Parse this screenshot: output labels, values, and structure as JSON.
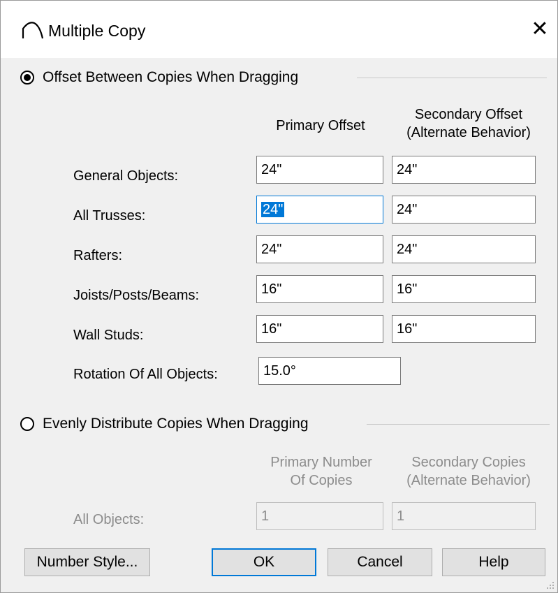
{
  "window": {
    "title": "Multiple Copy",
    "app_icon": "roof-arc-icon",
    "close_glyph": "✕"
  },
  "offset_group": {
    "label": "Offset Between Copies When Dragging",
    "selected": true,
    "col_primary": "Primary Offset",
    "col_secondary_line1": "Secondary Offset",
    "col_secondary_line2": "(Alternate Behavior)",
    "rows": [
      {
        "label": "General Objects:",
        "primary": "24\"",
        "secondary": "24\""
      },
      {
        "label": "All Trusses:",
        "primary": "24\"",
        "secondary": "24\""
      },
      {
        "label": "Rafters:",
        "primary": "24\"",
        "secondary": "24\""
      },
      {
        "label": "Joists/Posts/Beams:",
        "primary": "16\"",
        "secondary": "16\""
      },
      {
        "label": "Wall Studs:",
        "primary": "16\"",
        "secondary": "16\""
      }
    ],
    "rotation_label": "Rotation Of All Objects:",
    "rotation_value": "15.0°"
  },
  "distribute_group": {
    "label": "Evenly Distribute Copies When Dragging",
    "selected": false,
    "col_primary_line1": "Primary Number",
    "col_primary_line2": "Of Copies",
    "col_secondary_line1": "Secondary Copies",
    "col_secondary_line2": "(Alternate Behavior)",
    "row_label": "All Objects:",
    "primary": "1",
    "secondary": "1"
  },
  "buttons": {
    "number_style": "Number Style...",
    "ok": "OK",
    "cancel": "Cancel",
    "help": "Help"
  },
  "colors": {
    "focus_accent": "#0078d7",
    "disabled_text": "#8c8c8c",
    "dialog_bg": "#f0f0f0"
  }
}
